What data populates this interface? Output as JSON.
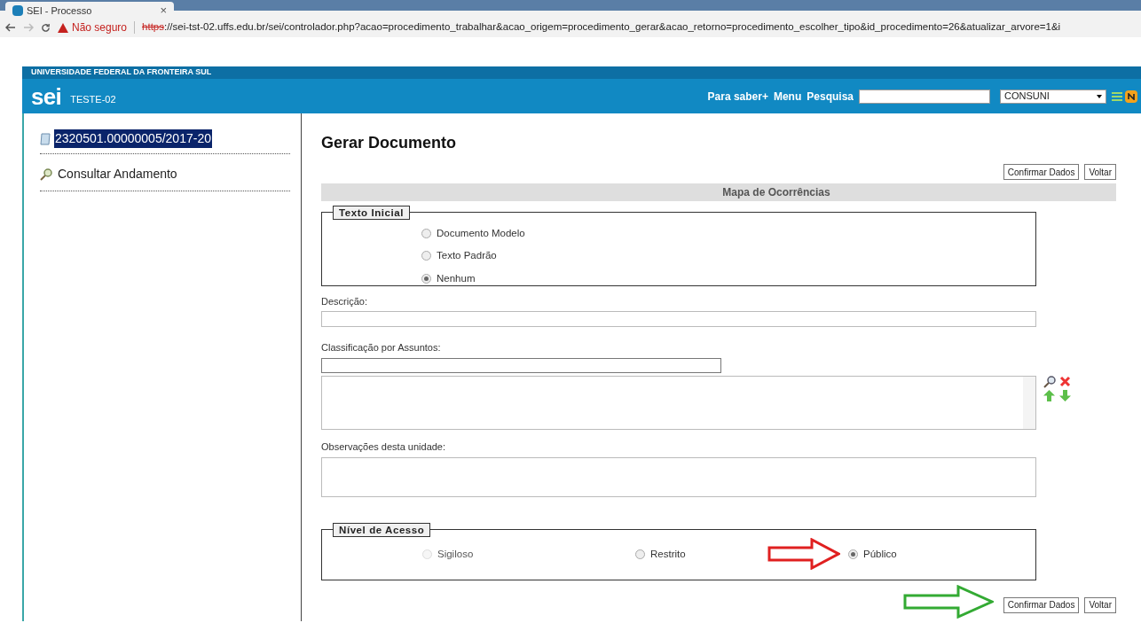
{
  "browser": {
    "tab_title": "SEI - Processo",
    "tab_close": "×",
    "security": "Não seguro",
    "url_scheme": "https",
    "url_rest": "://sei-tst-02.uffs.edu.br/sei/controlador.php?acao=procedimento_trabalhar&acao_origem=procedimento_gerar&acao_retorno=procedimento_escolher_tipo&id_procedimento=26&atualizar_arvore=1&i"
  },
  "header": {
    "institution": "UNIVERSIDADE FEDERAL DA FRONTEIRA SUL",
    "logo": "sei",
    "environment": "TESTE-02",
    "links": [
      "Para saber+",
      "Menu",
      "Pesquisa"
    ],
    "unit": "CONSUNI"
  },
  "tree": {
    "items": [
      {
        "label": "2320501.00000005/2017-20",
        "kind": "process",
        "selected": true
      },
      {
        "label": "Consultar Andamento",
        "kind": "search",
        "selected": false
      }
    ]
  },
  "form": {
    "title": "Gerar Documento",
    "buttons": [
      "Confirmar Dados",
      "Voltar"
    ],
    "section": "Mapa de Ocorrências",
    "texto_inicial": {
      "legend": "Texto Inicial",
      "options": [
        {
          "label": "Documento Modelo",
          "selected": false
        },
        {
          "label": "Texto Padrão",
          "selected": false
        },
        {
          "label": "Nenhum",
          "selected": true
        }
      ]
    },
    "descricao_label": "Descrição:",
    "classificacao_label": "Classificação por Assuntos:",
    "observacoes_label": "Observações desta unidade:",
    "nivel_acesso": {
      "legend": "Nível de Acesso",
      "options": [
        {
          "label": "Sigiloso",
          "selected": false,
          "disabled": true
        },
        {
          "label": "Restrito",
          "selected": false,
          "disabled": false
        },
        {
          "label": "Público",
          "selected": true,
          "disabled": false
        }
      ]
    },
    "bottom_buttons": [
      "Confirmar Dados",
      "Voltar"
    ]
  }
}
